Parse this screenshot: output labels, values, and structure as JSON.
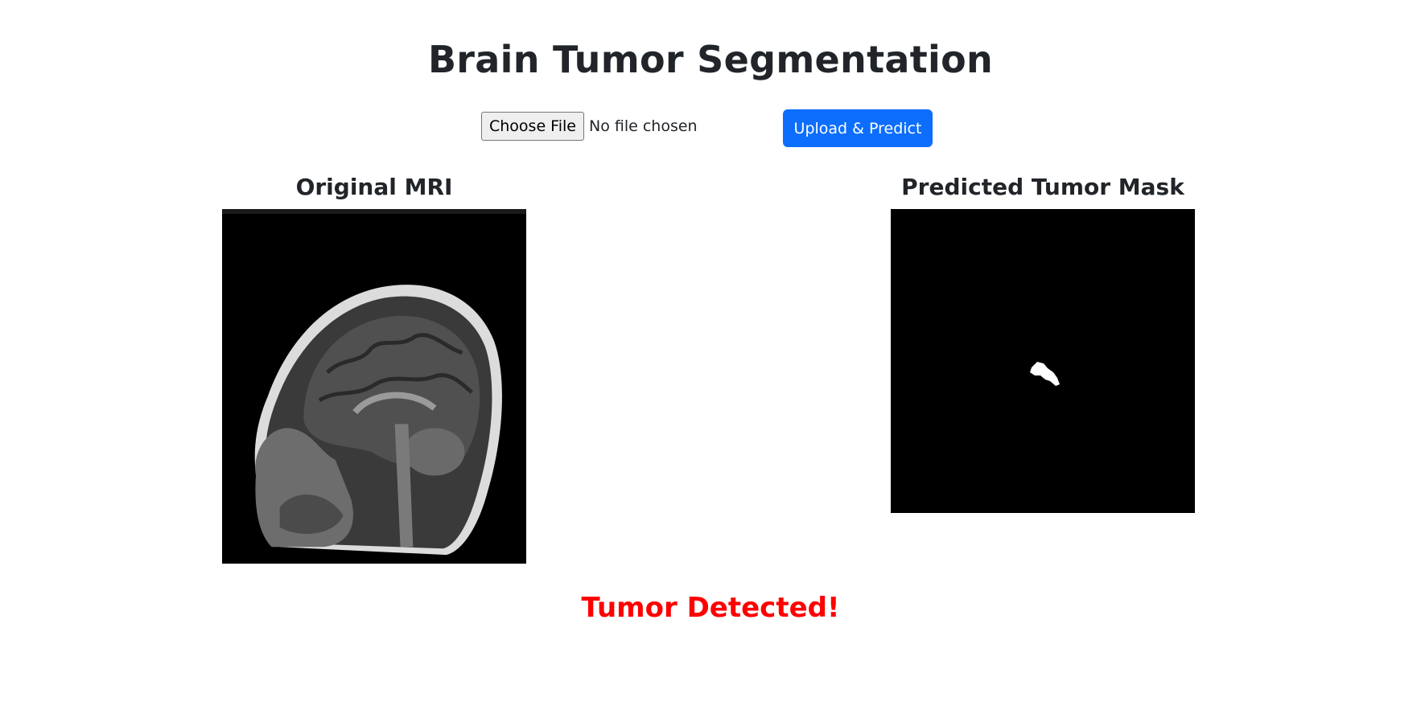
{
  "page": {
    "title": "Brain Tumor Segmentation"
  },
  "upload_form": {
    "choose_file_label": "Choose File",
    "file_status": "No file chosen",
    "submit_label": "Upload & Predict"
  },
  "panels": {
    "original": {
      "title": "Original MRI"
    },
    "mask": {
      "title": "Predicted Tumor Mask"
    }
  },
  "result": {
    "text": "Tumor Detected!",
    "color": "#ff0000"
  },
  "colors": {
    "primary_button": "#0d6efd",
    "text": "#212529",
    "image_background": "#000000"
  }
}
